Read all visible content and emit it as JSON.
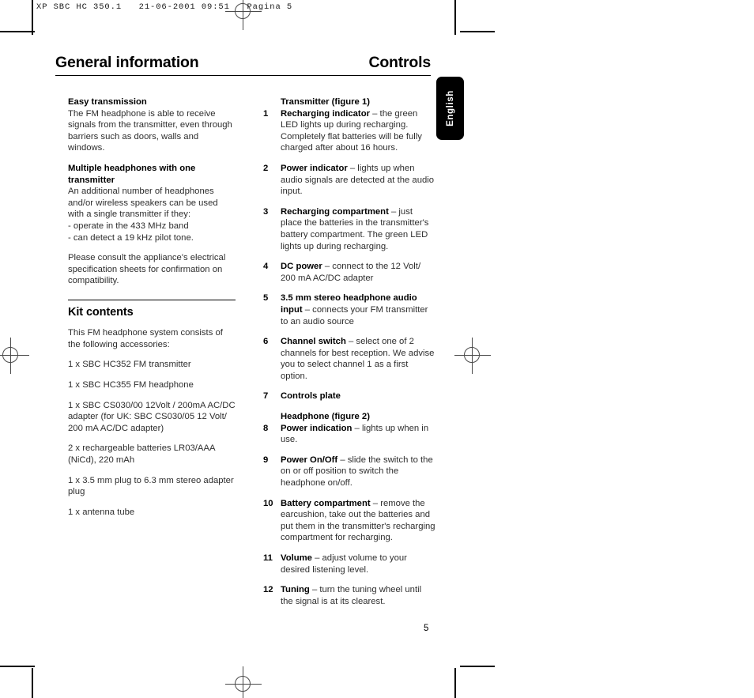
{
  "prepress": {
    "slug": "XP SBC HC 350.1   21-06-2001 09:51   Pagina 5"
  },
  "header": {
    "left_title": "General information",
    "right_title": "Controls"
  },
  "language_tab": {
    "label": "English"
  },
  "left_column": {
    "blocks": [
      {
        "heading": "Easy transmission",
        "body": "The FM headphone is able to receive signals from the transmitter, even through barriers such as doors, walls and windows."
      },
      {
        "heading": "Multiple headphones with one transmitter",
        "body": "An additional number of headphones and/or wireless speakers can be used with a single transmitter if they:\n- operate in the 433 MHz band\n- can detect a 19 kHz pilot tone."
      },
      {
        "heading": "",
        "body": "Please consult the appliance's electrical specification sheets for confirmation on compatibility."
      }
    ],
    "section_title": "Kit contents",
    "section_intro": "This FM headphone system consists of the following accessories:",
    "kit_items": [
      "1 x SBC HC352 FM transmitter",
      "1 x SBC HC355 FM headphone",
      "1 x SBC CS030/00 12Volt / 200mA AC/DC adapter (for UK: SBC CS030/05 12 Volt/ 200 mA AC/DC adapter)",
      "2 x rechargeable batteries LR03/AAA (NiCd), 220 mAh",
      "1 x 3.5 mm plug to 6.3 mm stereo adapter plug",
      "1 x antenna tube"
    ]
  },
  "right_column": {
    "group1_heading": "Transmitter (figure 1)",
    "group2_heading": "Headphone (figure 2)",
    "controls": [
      {
        "num": "1",
        "term": "Recharging indicator",
        "desc": " – the green LED lights up during recharging. Completely flat batteries will be fully charged after about 16 hours."
      },
      {
        "num": "2",
        "term": "Power indicator",
        "desc": " – lights up when audio signals are detected at the audio input."
      },
      {
        "num": "3",
        "term": "Recharging compartment",
        "desc": " – just place the batteries in the transmitter's battery compartment. The green LED lights up during recharging."
      },
      {
        "num": "4",
        "term": "DC power",
        "desc": " – connect to the 12 Volt/ 200 mA AC/DC adapter"
      },
      {
        "num": "5",
        "term": "3.5 mm stereo headphone audio input",
        "desc": " – connects your FM transmitter to an audio source"
      },
      {
        "num": "6",
        "term": "Channel switch",
        "desc": " – select one of 2 channels for best reception. We advise you to select channel 1 as a first option."
      },
      {
        "num": "7",
        "term": "Controls plate",
        "desc": ""
      },
      {
        "num": "8",
        "term": "Power indication",
        "desc": " – lights up when in use."
      },
      {
        "num": "9",
        "term": "Power On/Off",
        "desc": " – slide the switch to the on or off position to switch the headphone on/off."
      },
      {
        "num": "10",
        "term": "Battery compartment",
        "desc": " – remove the earcushion, take out the batteries and put them in the transmitter's recharging compartment for recharging."
      },
      {
        "num": "11",
        "term": "Volume",
        "desc": " – adjust volume to your desired listening level."
      },
      {
        "num": "12",
        "term": "Tuning",
        "desc": " – turn the tuning wheel until the signal is at its clearest."
      }
    ]
  },
  "folio": {
    "page_number": "5"
  }
}
